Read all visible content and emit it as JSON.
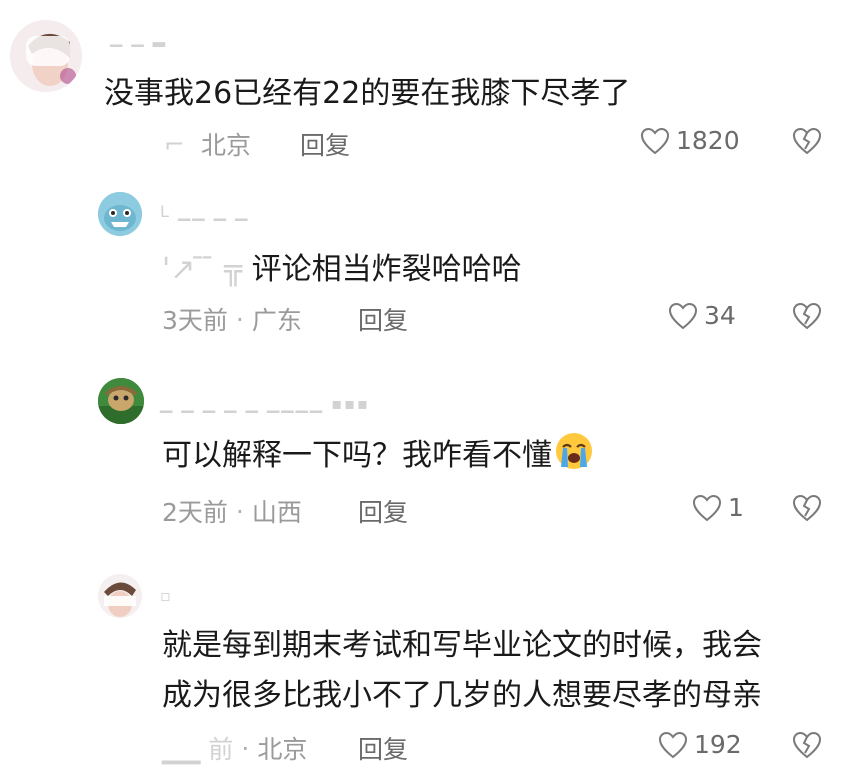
{
  "comments": [
    {
      "username": "",
      "text": "没事我26已经有22的要在我膝下尽孝了",
      "date": "",
      "location": "北京",
      "reply_label": "回复",
      "likes": "1820"
    },
    {
      "username": "",
      "text_prefix": "",
      "text": "评论相当炸裂哈哈哈",
      "date": "3天前",
      "location": "广东",
      "reply_label": "回复",
      "likes": "34"
    },
    {
      "username": "",
      "text": "可以解释一下吗？我咋看不懂",
      "emoji": "loudly-crying-face",
      "date": "2天前",
      "location": "山西",
      "reply_label": "回复",
      "likes": "1"
    },
    {
      "username": "",
      "text_line1": "就是每到期末考试和写毕业论文的时候，我会",
      "text_line2": "成为很多比我小不了几岁的人想要尽孝的母亲",
      "date": "",
      "location": "北京",
      "reply_label": "回复",
      "likes": "192"
    }
  ],
  "colors": {
    "text": "#1a1a1a",
    "meta": "#9a9a9a",
    "icon": "#7a7a7a",
    "background": "#ffffff"
  },
  "icons": {
    "like": "heart-outline-icon",
    "dislike": "broken-heart-icon"
  }
}
